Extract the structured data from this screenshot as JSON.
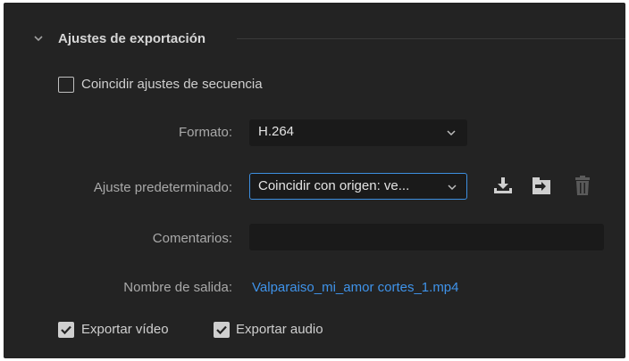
{
  "section": {
    "title": "Ajustes de exportación",
    "expanded": true
  },
  "match_sequence": {
    "label": "Coincidir ajustes de secuencia",
    "checked": false
  },
  "format": {
    "label": "Formato:",
    "value": "H.264"
  },
  "preset": {
    "label": "Ajuste predeterminado:",
    "value": "Coincidir con origen: ve...",
    "icons": [
      "save-preset-icon",
      "import-preset-icon",
      "delete-preset-icon"
    ]
  },
  "comments": {
    "label": "Comentarios:",
    "value": ""
  },
  "output_name": {
    "label": "Nombre de salida:",
    "value": "Valparaiso_mi_amor cortes_1.mp4"
  },
  "export_video": {
    "label": "Exportar vídeo",
    "checked": true
  },
  "export_audio": {
    "label": "Exportar audio",
    "checked": true
  },
  "colors": {
    "accent": "#3f93ea",
    "panel": "#232323",
    "field": "#1a1a1a",
    "focus": "#3d8fe0"
  }
}
